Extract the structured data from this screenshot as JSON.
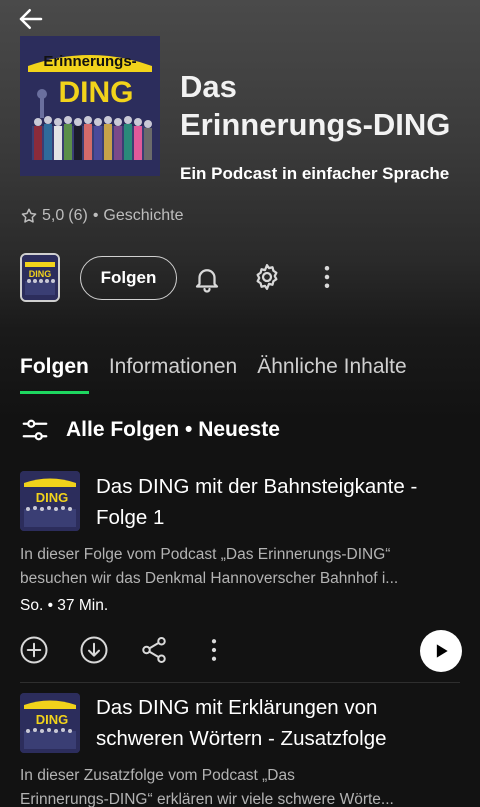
{
  "show": {
    "title_line1": "Das",
    "title_line2": "Erinnerungs-DING",
    "subtitle": "Ein Podcast in einfacher Sprache",
    "rating": "5,0",
    "rating_count": "(6)",
    "separator": "•",
    "category": "Geschichte",
    "cover_banner": "Erinnerungs-",
    "cover_logo": "DING"
  },
  "actions": {
    "follow_label": "Folgen"
  },
  "tabs": [
    {
      "label": "Folgen",
      "active": true
    },
    {
      "label": "Informationen",
      "active": false
    },
    {
      "label": "Ähnliche Inhalte",
      "active": false
    }
  ],
  "filter": {
    "label": "Alle Folgen • Neueste"
  },
  "episodes": [
    {
      "title_line1": "Das DING mit der Bahnsteigkante -",
      "title_line2": "Folge 1",
      "desc_line1": "In dieser Folge vom Podcast „Das Erinnerungs-DING“",
      "desc_line2": "besuchen wir das Denkmal Hannoverscher Bahnhof i...",
      "meta": "So. • 37 Min."
    },
    {
      "title_line1": "Das DING mit Erklärungen von",
      "title_line2": "schweren Wörtern - Zusatzfolge",
      "desc_line1": "In dieser Zusatzfolge vom Podcast „Das",
      "desc_line2": "Erinnerungs-DING“ erklären wir viele schwere Wörte..."
    }
  ],
  "colors": {
    "accent": "#1ed760",
    "cover_bg": "#2c2d5c",
    "cover_yellow": "#f2d31b"
  }
}
